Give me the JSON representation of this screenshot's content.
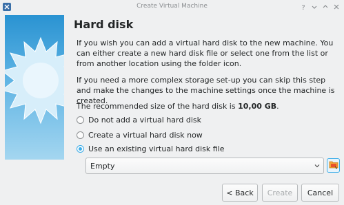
{
  "window": {
    "title": "Create Virtual Machine"
  },
  "titlebar_buttons": [
    "help-icon",
    "minimize-icon",
    "maximize-icon",
    "close-icon"
  ],
  "page": {
    "heading": "Hard disk",
    "paragraph1": "If you wish you can add a virtual hard disk to the new machine. You can either create a new hard disk file or select one from the list or from another location using the folder icon.",
    "paragraph2": "If you need a more complex storage set-up you can skip this step and make the changes to the machine settings once the machine is created.",
    "recommended_prefix": "The recommended size of the hard disk is ",
    "recommended_size": "10,00 GB",
    "recommended_suffix": "."
  },
  "options": {
    "none": "Do not add a virtual hard disk",
    "create": "Create a virtual hard disk now",
    "existing": "Use an existing virtual hard disk file",
    "selected": "existing"
  },
  "disk_combo": {
    "value": "Empty"
  },
  "buttons": {
    "back": "< Back",
    "create": "Create",
    "cancel": "Cancel"
  },
  "colors": {
    "accent": "#3daee9",
    "sidebar_top": "#2a93d2",
    "sidebar_bottom": "#a4d6f0"
  }
}
